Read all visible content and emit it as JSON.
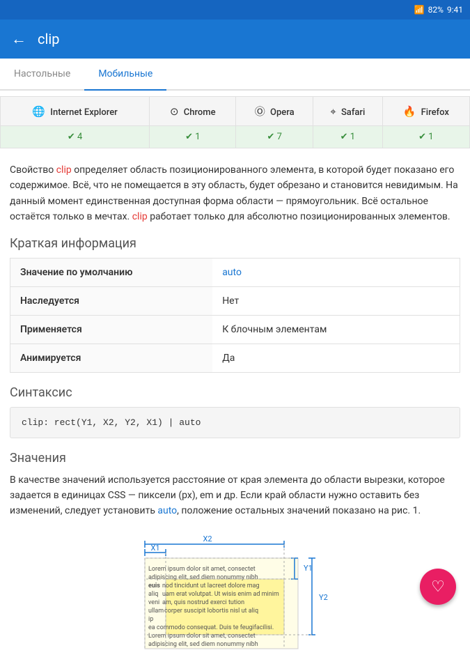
{
  "statusBar": {
    "battery": "82%",
    "time": "9:41",
    "wifiIcon": "wifi",
    "signalIcon": "signal",
    "batteryIcon": "battery"
  },
  "topBar": {
    "backIcon": "←",
    "title": "clip"
  },
  "fab": {
    "icon": "♡"
  },
  "tabs": [
    {
      "id": "desktop",
      "label": "Настольные",
      "active": false
    },
    {
      "id": "mobile",
      "label": "Мобильные",
      "active": true
    }
  ],
  "browsers": {
    "headers": [
      "Internet Explorer",
      "Chrome",
      "Opera",
      "Safari",
      "Firefox"
    ],
    "icons": [
      "ie",
      "chrome",
      "opera",
      "safari",
      "firefox"
    ],
    "versions": [
      "4",
      "1",
      "7",
      "1",
      "1"
    ]
  },
  "description": "Свойство clip определяет область позиционированного элемента, в которой будет показано его содержимое. Всё, что не помещается в эту область, будет обрезано и становится невидимым. На данный момент единственная доступная форма области — прямоугольник. Всё остальное остаётся только в мечтах. clip работает только для абсолютно позиционированных элементов.",
  "descriptionLinks": [
    "clip",
    "clip"
  ],
  "sectionBrief": "Краткая информация",
  "briefTable": [
    {
      "key": "Значение по умолчанию",
      "value": "auto",
      "isAuto": true
    },
    {
      "key": "Наследуется",
      "value": "Нет",
      "isAuto": false
    },
    {
      "key": "Применяется",
      "value": "К блочным элементам",
      "isAuto": false
    },
    {
      "key": "Анимируется",
      "value": "Да",
      "isAuto": false
    }
  ],
  "sectionSyntax": "Синтаксис",
  "syntaxCode": "clip: rect(Y1, X2, Y2, X1) | auto",
  "sectionValues": "Значения",
  "valuesDescription": "В качестве значений используется расстояние от края элемента до области вырезки, которое задается в единицах CSS — пиксели (px), em и др. Если край области нужно оставить без изменений, следует установить auto, положение остальных значений показано на рис. 1.",
  "diagram": {
    "x2Label": "X2",
    "x1Label": "X1",
    "y1Label": "Y1",
    "y2Label": "Y2"
  }
}
